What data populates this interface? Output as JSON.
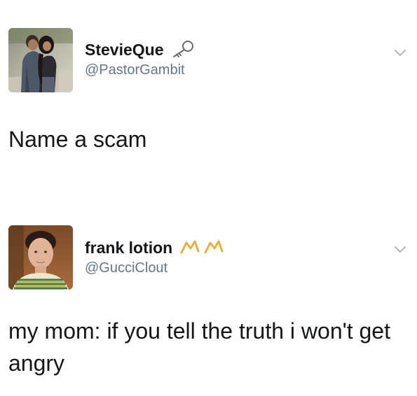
{
  "tweets": [
    {
      "display_name": "StevieQue",
      "handle": "@PastorGambit",
      "name_emoji": "key-emoji",
      "text": "Name a scam",
      "avatar": "couple-photo-avatar"
    },
    {
      "display_name": "frank lotion",
      "handle": "@GucciClout",
      "name_emoji": "crown-emoji",
      "text": "my mom: if you tell the truth i won't get angry",
      "avatar": "selfie-photo-avatar"
    }
  ],
  "icons": {
    "menu": "chevron-down-icon"
  },
  "colors": {
    "text": "#14171a",
    "secondary": "#657786",
    "chevron": "#aab8c2",
    "crown": "#e8b03a",
    "background": "#ffffff"
  }
}
